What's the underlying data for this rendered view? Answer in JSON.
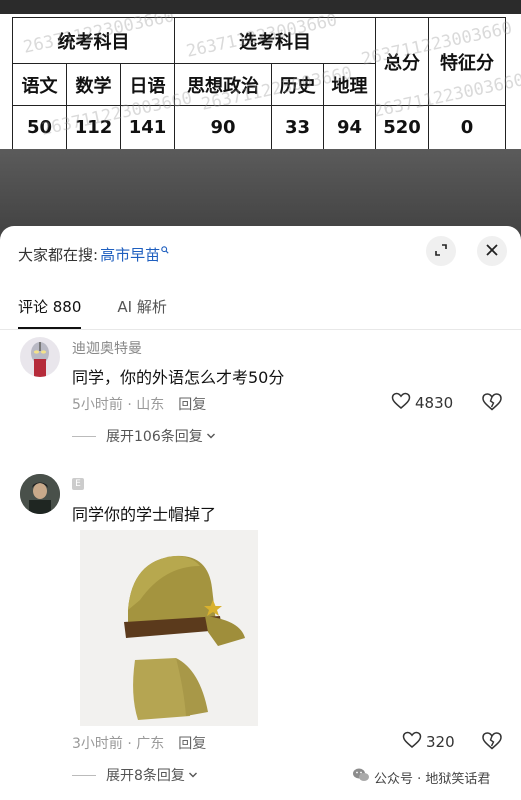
{
  "score_table": {
    "group_headers": {
      "unified": "统考科目",
      "elective": "选考科目",
      "total": "总分",
      "feature": "特征分"
    },
    "subjects": [
      "语文",
      "数学",
      "日语",
      "思想政治",
      "历史",
      "地理"
    ],
    "scores": [
      "50",
      "112",
      "141",
      "90",
      "33",
      "94",
      "520",
      "0"
    ],
    "watermark": "263711223003660"
  },
  "sheet": {
    "search_prefix": "大家都在搜:",
    "search_term": "高市早苗",
    "tabs": [
      "评论 880",
      "AI 解析"
    ]
  },
  "comments": [
    {
      "user": "迪迦奥特曼",
      "text": "同学，你的外语怎么才考50分",
      "time_loc": "5小时前 · 山东",
      "reply_label": "回复",
      "likes": "4830",
      "expand": "展开106条回复"
    },
    {
      "user": "",
      "badge": "E",
      "text": "同学你的学士帽掉了",
      "time_loc": "3小时前 · 广东",
      "reply_label": "回复",
      "likes": "320",
      "expand": "展开8条回复"
    }
  ],
  "footer": {
    "label": "公众号 · 地狱笑话君"
  },
  "icons": {
    "search_suffix": "search-icon",
    "expand": "expand-icon",
    "close": "close-icon",
    "like": "heart-icon",
    "dislike": "broken-heart-icon",
    "chevron": "chevron-down-icon",
    "wechat": "wechat-icon"
  },
  "colors": {
    "link": "#1f5fbf",
    "muted": "#999999",
    "text": "#111111"
  }
}
